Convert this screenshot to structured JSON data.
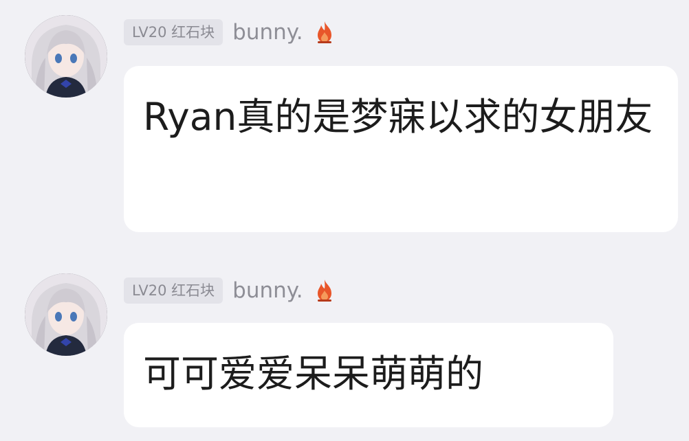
{
  "messages": [
    {
      "badge": "LV20 红石块",
      "username": "bunny.",
      "text": "Ryan真的是梦寐以求的女朋友"
    },
    {
      "badge": "LV20 红石块",
      "username": "bunny.",
      "text": "可可爱爱呆呆萌萌的"
    }
  ],
  "icons": {
    "avatar": "anime-girl-avatar",
    "flame": "flame-icon"
  },
  "colors": {
    "background": "#f1f1f5",
    "bubble": "#ffffff",
    "badge_bg": "#e3e3e9",
    "badge_text": "#8a8a92",
    "flame": "#e8562a"
  }
}
